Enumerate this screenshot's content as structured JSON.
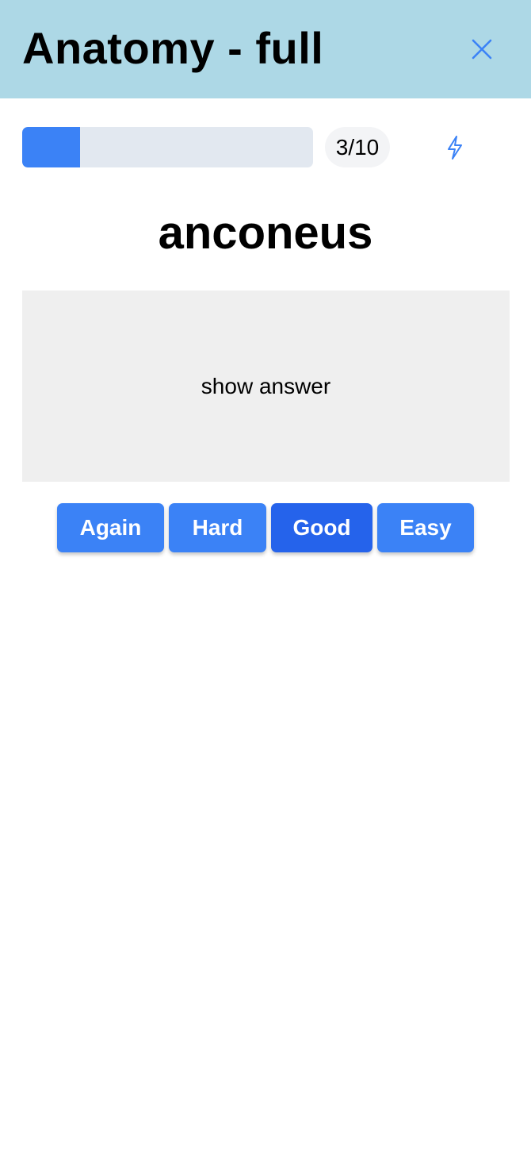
{
  "header": {
    "title": "Anatomy - full",
    "close_icon": "close-icon",
    "background": "#add8e6"
  },
  "progress": {
    "current": 3,
    "total": 10,
    "fill_fraction": 0.2,
    "counter_label": "3/10",
    "fill_color": "#3b82f6",
    "track_color": "#e2e8f0"
  },
  "toolbar": {
    "bolt_icon": "lightning-bolt-icon"
  },
  "card": {
    "word": "anconeus",
    "show_answer_label": "show answer"
  },
  "ratings": {
    "again": "Again",
    "hard": "Hard",
    "good": "Good",
    "easy": "Easy",
    "accent": "#3b82f6",
    "active_accent": "#2563eb"
  }
}
